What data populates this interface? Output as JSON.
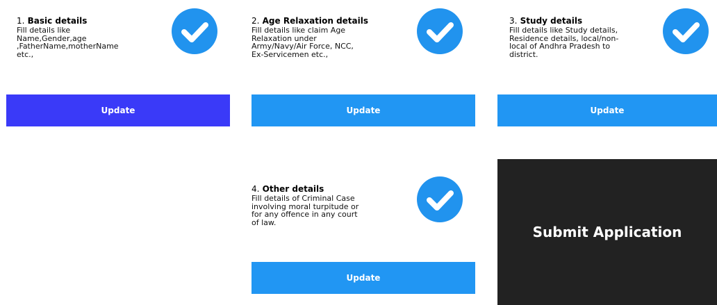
{
  "sections": [
    {
      "number": "1.",
      "title": "Basic details",
      "description": " Fill details like\nName,Gender,age\n,FatherName,motherName\netc.,",
      "update_label": "Update",
      "update_color": "#3a3af8",
      "completed": true
    },
    {
      "number": "2.",
      "title": "Age Relaxation details",
      "description": " Fill details like claim Age\nRelaxation under\nArmy/Navy/Air Force, NCC,\nEx-Servicemen etc.,",
      "update_label": "Update",
      "update_color": "#2196f3",
      "completed": true
    },
    {
      "number": "3.",
      "title": "Study details",
      "description": "Fill details like Study details,\nResidence details, local/non-\nlocal of Andhra Pradesh to\ndistrict.",
      "update_label": "Update",
      "update_color": "#2196f3",
      "completed": true
    },
    {
      "number": "4.",
      "title": "Other details",
      "description": "Fill details of Criminal Case\ninvolving moral turpitude or\nfor any offence in any court\nof law.",
      "update_label": "Update",
      "update_color": "#2196f3",
      "completed": true
    }
  ],
  "submit": {
    "label": "Submit Application",
    "color": "#222222"
  },
  "check_icon": "check-circle-icon",
  "check_color": "#2193ee"
}
